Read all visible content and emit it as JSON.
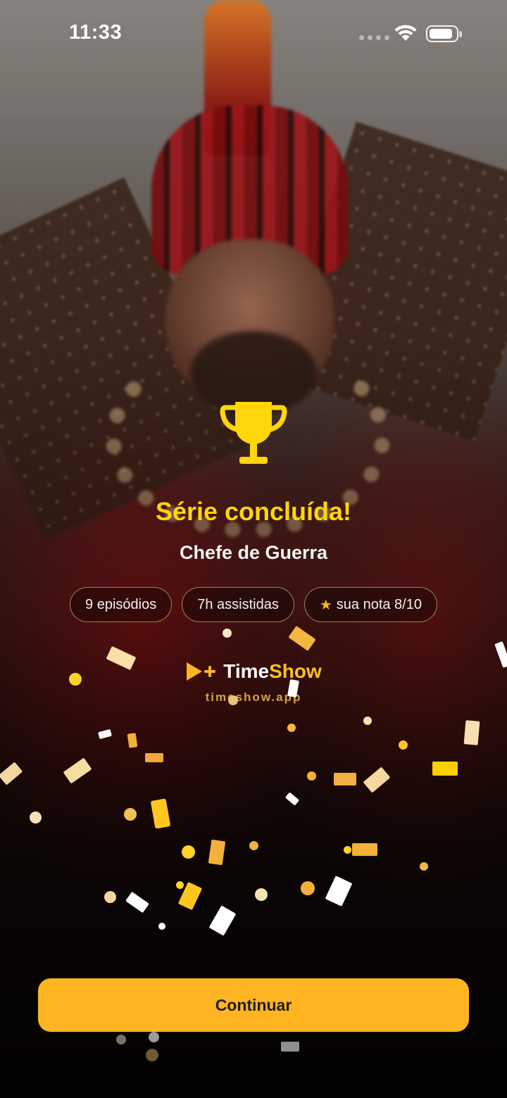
{
  "status_bar": {
    "time": "11:33"
  },
  "completion": {
    "title": "Série concluída!",
    "show_name": "Chefe de Guerra"
  },
  "stats": [
    {
      "label": "9 episódios"
    },
    {
      "label": "7h assistidas"
    },
    {
      "label": "sua nota 8/10",
      "icon": "star-icon"
    }
  ],
  "brand": {
    "name_part1": "Time",
    "name_part2": "Show",
    "url": "timeshow.app",
    "accent_color": "#FFC01E"
  },
  "actions": {
    "continue_label": "Continuar"
  },
  "colors": {
    "title": "#FFD60A",
    "button": "#FFB422"
  }
}
